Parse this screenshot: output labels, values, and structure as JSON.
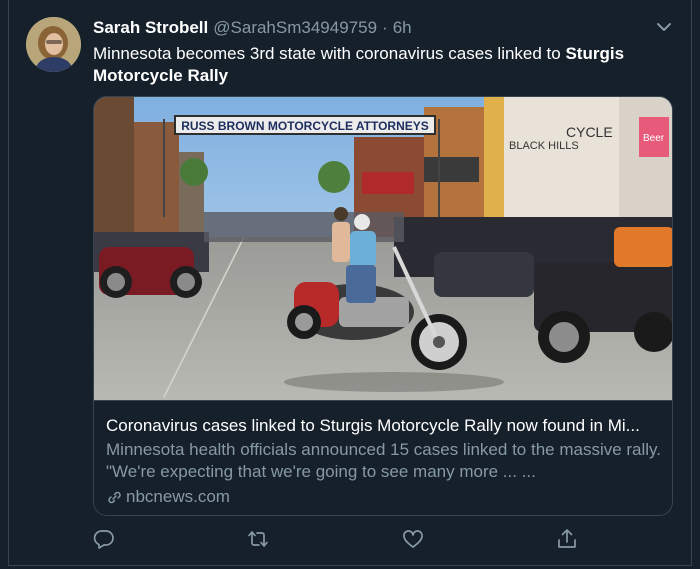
{
  "tweet": {
    "author_name": "Sarah Strobell",
    "author_handle": "@SarahSm34949759",
    "separator": "·",
    "time": "6h",
    "text_plain": "Minnesota becomes 3rd state with coronavirus cases linked to ",
    "text_bold": "Sturgis Motorcycle Rally"
  },
  "card": {
    "image_texts": {
      "banner": "RUSS BROWN MOTORCYCLE ATTORNEYS",
      "shop_sign": "BLACK HILLS",
      "shop_sign2": "CYCLE",
      "beer_sign": "Beer"
    },
    "title": "Coronavirus cases linked to Sturgis Motorcycle Rally now found in Mi...",
    "description": "Minnesota health officials announced 15 cases linked to the massive rally. \"We're expecting that we're going to see many more ... ...",
    "domain": "nbcnews.com"
  },
  "icons": {
    "caret": "chevron-down-icon",
    "reply": "reply-icon",
    "retweet": "retweet-icon",
    "like": "heart-icon",
    "share": "share-icon",
    "link": "link-icon"
  },
  "colors": {
    "background": "#15202b",
    "border": "#38444d",
    "secondary_text": "#8899a6"
  }
}
